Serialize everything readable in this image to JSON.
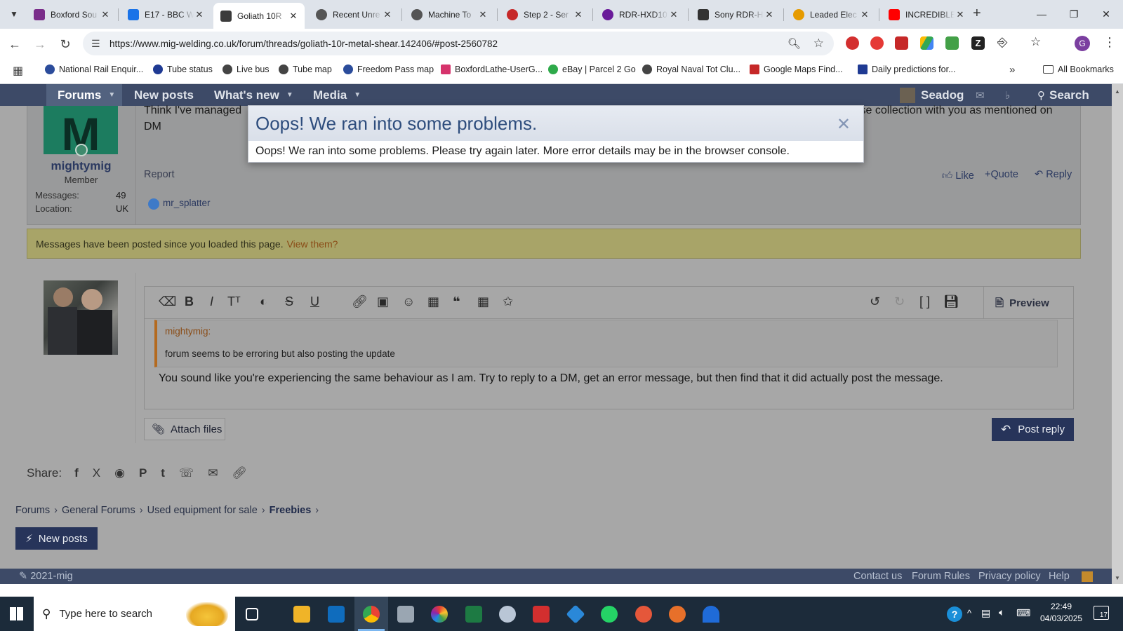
{
  "browser": {
    "tabs": [
      {
        "title": "Boxford Sou",
        "color": "#7a2d8a"
      },
      {
        "title": "E17 - BBC W",
        "color": "#1a73e8"
      },
      {
        "title": "Goliath 10R",
        "color": "#3b3b3b",
        "active": true
      },
      {
        "title": "Recent Unre",
        "color": "#444444"
      },
      {
        "title": "Machine To",
        "color": "#555555"
      },
      {
        "title": "Step 2 - Ser",
        "color": "#c62828"
      },
      {
        "title": "RDR-HXD10",
        "color": "#6a1b9a"
      },
      {
        "title": "Sony RDR-H",
        "color": "#333333"
      },
      {
        "title": "Leaded Elec",
        "color": "#e69b00"
      },
      {
        "title": "INCREDIBLE",
        "color": "#ff0000"
      }
    ],
    "url": "https://www.mig-welding.co.uk/forum/threads/goliath-10r-metal-shear.142406/#post-2560782",
    "profile_initial": "G",
    "bookmarks": [
      {
        "label": "National Rail Enquir...",
        "color": "#2b4c9b"
      },
      {
        "label": "Tube status",
        "color": "#1f3a93"
      },
      {
        "label": "Live bus",
        "color": "#333333"
      },
      {
        "label": "Tube map",
        "color": "#333333"
      },
      {
        "label": "Freedom Pass map",
        "color": "#2b4c9b"
      },
      {
        "label": "BoxfordLathe-UserG...",
        "color": "#d6336c"
      },
      {
        "label": "eBay | Parcel 2 Go",
        "color": "#2eaa4a"
      },
      {
        "label": "Royal Naval Tot Clu...",
        "color": "#333333"
      },
      {
        "label": "Google Maps Find...",
        "color": "#c62828"
      },
      {
        "label": "Daily predictions for...",
        "color": "#1f3a93"
      }
    ],
    "all_bookmarks": "All Bookmarks"
  },
  "forum": {
    "nav": {
      "forums": "Forums",
      "new_posts": "New posts",
      "whats_new": "What's new",
      "media": "Media",
      "user": "Seadog",
      "search": "Search"
    },
    "post": {
      "avatar_letter": "M",
      "author": "mightymig",
      "role": "Member",
      "messages_label": "Messages:",
      "messages_value": "49",
      "location_label": "Location:",
      "location_value": "UK",
      "body_line1": "Think I've managed",
      "body_line1_end": "ise collection with you as mentioned on",
      "body_line2": "DM",
      "report": "Report",
      "like": "Like",
      "quote": "Quote",
      "reply": "Reply",
      "liked_by": "mr_splatter"
    },
    "alert_text": "Messages have been posted since you loaded this page.",
    "alert_link": "View them?",
    "editor": {
      "quote_author": "mightymig:",
      "quote_text": "forum seems to be erroring but also posting the update",
      "reply_text": "You sound like you're experiencing the same behaviour as I am. Try to reply to a DM, get an error message, but then find that it did actually post the message.",
      "preview": "Preview",
      "attach": "Attach files",
      "post_reply": "Post reply"
    },
    "share_label": "Share:",
    "breadcrumbs": [
      "Forums",
      "General Forums",
      "Used equipment for sale",
      "Freebies"
    ],
    "new_posts_button": "New posts",
    "footer": {
      "left": "2021-mig",
      "links": [
        "Contact us",
        "Forum Rules",
        "Privacy policy",
        "Help"
      ]
    }
  },
  "modal": {
    "title": "Oops! We ran into some problems.",
    "message": "Oops! We ran into some problems. Please try again later. More error details may be in the browser console."
  },
  "taskbar": {
    "search_placeholder": "Type here to search",
    "time": "22:49",
    "date": "04/03/2025",
    "notifications": "17"
  }
}
